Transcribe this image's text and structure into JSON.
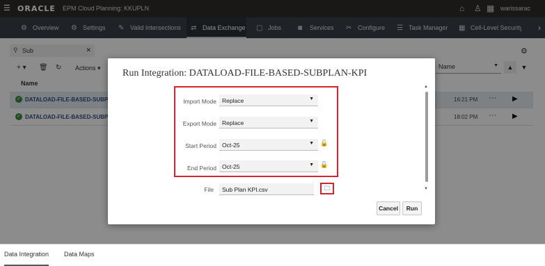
{
  "header": {
    "logo": "ORACLE",
    "app_title": "EPM Cloud Planning: KKUPLN",
    "username": "warissarac"
  },
  "nav": {
    "tabs": [
      {
        "label": "Overview",
        "icon": "⚙"
      },
      {
        "label": "Settings",
        "icon": "⚙"
      },
      {
        "label": "Valid Intersections",
        "icon": "✎"
      },
      {
        "label": "Data Exchange",
        "icon": "⇄"
      },
      {
        "label": "Jobs",
        "icon": "▢"
      },
      {
        "label": "Services",
        "icon": "◙"
      },
      {
        "label": "Configure",
        "icon": "✂"
      },
      {
        "label": "Task Manager",
        "icon": "☰"
      },
      {
        "label": "Cell-Level Security",
        "icon": "▦"
      }
    ]
  },
  "search": {
    "value": "Sub"
  },
  "toolbar": {
    "add": "+ ▾",
    "actions_label": "Actions ▾"
  },
  "sort": {
    "selected": "Name"
  },
  "list": {
    "column_name": "Name",
    "rows": [
      {
        "name": "DATALOAD-FILE-BASED-SUBPLAN-KF",
        "time": "16:21 PM"
      },
      {
        "name": "DATALOAD-FILE-BASED-SUBPLAN-KF",
        "time": "18:02 PM"
      }
    ]
  },
  "bottom_tabs": [
    "Data Integration",
    "Data Maps"
  ],
  "dialog": {
    "title": "Run Integration: DATALOAD-FILE-BASED-SUBPLAN-KPI",
    "fields": {
      "import_mode_label": "Import Mode",
      "import_mode_value": "Replace",
      "export_mode_label": "Export Mode",
      "export_mode_value": "Replace",
      "start_period_label": "Start Period",
      "start_period_value": "Oct-25",
      "end_period_label": "End Period",
      "end_period_value": "Oct-25",
      "file_label": "File",
      "file_value": "Sub Plan KPI.csv"
    },
    "cancel_label": "Cancel",
    "run_label": "Run"
  },
  "colors": {
    "highlight": "#d4232c",
    "topbar": "#312d2a",
    "navbar": "#3a4147"
  }
}
